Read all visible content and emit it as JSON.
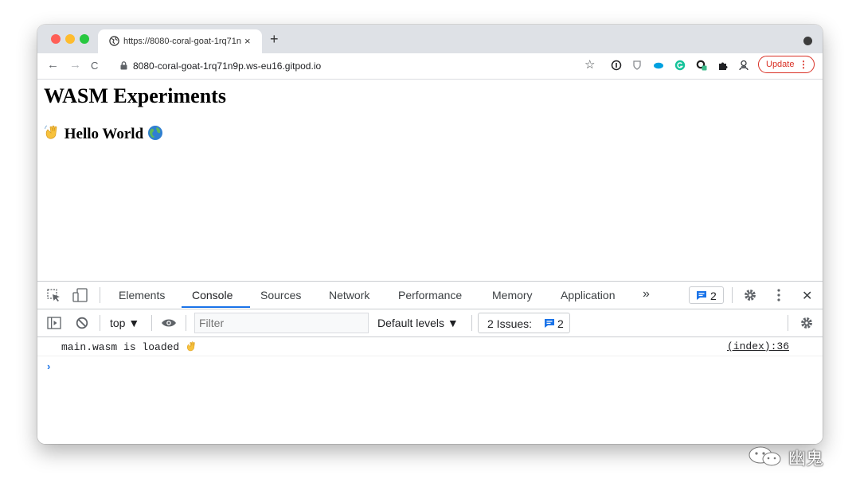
{
  "browser": {
    "tab": {
      "title": "https://8080-coral-goat-1rq71n",
      "close": "×"
    },
    "new_tab": "+",
    "toolbar": {
      "back": "←",
      "forward": "→",
      "reload": "C",
      "url": "8080-coral-goat-1rq71n9p.ws-eu16.gitpod.io",
      "bookmark": "☆",
      "update_label": "Update",
      "menu": "⋮"
    },
    "extension_icons": [
      "info-icon",
      "shield-extension-icon",
      "salesforce-icon",
      "grammarly-icon",
      "meta-mask-icon",
      "puzzle-icon",
      "profile-icon"
    ]
  },
  "page": {
    "heading": "WASM Experiments",
    "subheading": "Hello World",
    "subheading_emoji_left": "wave-emoji",
    "subheading_emoji_right": "globe-emoji"
  },
  "devtools": {
    "tabs": [
      "Elements",
      "Console",
      "Sources",
      "Network",
      "Performance",
      "Memory",
      "Application"
    ],
    "active_tab": "Console",
    "more": "»",
    "issues_badge_count": "2",
    "close": "✕",
    "console_bar": {
      "context": "top ▼",
      "filter_placeholder": "Filter",
      "levels": "Default levels ▼",
      "issues_label": "2 Issues:",
      "issues_count": "2"
    },
    "messages": [
      {
        "text": "main.wasm is loaded",
        "source": "(index):36"
      }
    ],
    "prompt": "›"
  },
  "watermark": {
    "text": "幽鬼"
  },
  "colors": {
    "accent": "#1a73e8",
    "update": "#d93025",
    "tabstrip": "#dee1e6"
  }
}
